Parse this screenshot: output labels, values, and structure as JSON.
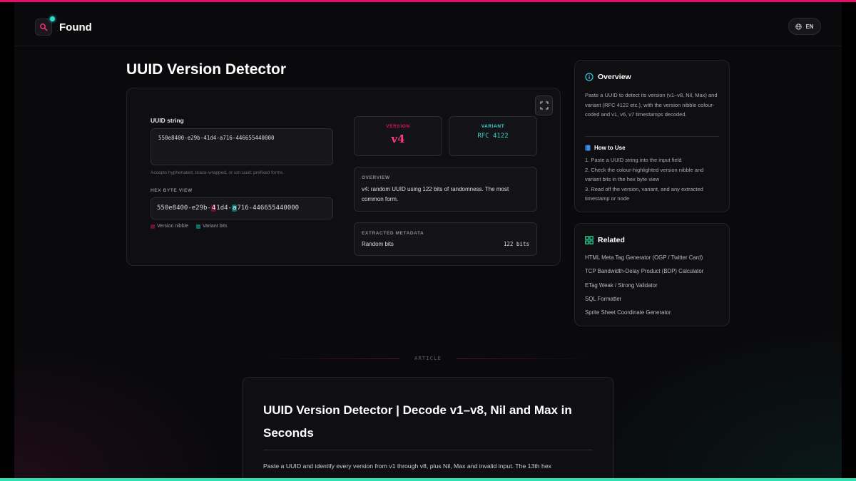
{
  "colors": {
    "accent_pink": "#e0106a",
    "accent_teal": "#2de0b0",
    "version_highlight": "#6a1238",
    "variant_highlight": "#0e6e6a"
  },
  "header": {
    "brand": "Found",
    "logo_icon": "search-icon",
    "language": "EN",
    "language_icon": "globe-icon"
  },
  "page": {
    "title": "UUID Version Detector"
  },
  "tool": {
    "input_label": "UUID string",
    "input_value": "550e8400-e29b-41d4-a716-446655440000",
    "input_hint": "Accepts hyphenated, brace-wrapped, or urn:uuid: prefixed forms.",
    "hex_label": "HEX BYTE VIEW",
    "hex": {
      "part1": "550e8400-e29b-",
      "version_nibble": "4",
      "part2": "1d4-",
      "variant_nibble": "a",
      "part3": "716-446655440000"
    },
    "legend_version": "Version nibble",
    "legend_variant": "Variant bits",
    "version_label": "VERSION",
    "version_value": "v4",
    "variant_label": "VARIANT",
    "variant_value": "RFC 4122",
    "overview_label": "OVERVIEW",
    "overview_text": "v4: random UUID using 122 bits of randomness. The most common form.",
    "metadata_label": "EXTRACTED METADATA",
    "metadata_key": "Random bits",
    "metadata_value": "122 bits",
    "fullscreen_icon": "expand-icon"
  },
  "sidebar": {
    "overview_title": "Overview",
    "overview_icon": "info-icon",
    "overview_text": "Paste a UUID to detect its version (v1–v8, Nil, Max) and variant (RFC 4122 etc.), with the version nibble colour-coded and v1, v6, v7 timestamps decoded.",
    "howto_title": "How to Use",
    "howto_icon": "book-icon",
    "howto_steps": [
      "1. Paste a UUID string into the input field",
      "2. Check the colour-highlighted version nibble and variant bits in the hex byte view",
      "3. Read off the version, variant, and any extracted timestamp or node"
    ],
    "related_title": "Related",
    "related_icon": "grid-icon",
    "related": [
      "HTML Meta Tag Generator (OGP / Twitter Card)",
      "TCP Bandwidth-Delay Product (BDP) Calculator",
      "ETag Weak / Strong Validator",
      "SQL Formatter",
      "Sprite Sheet Coordinate Generator"
    ]
  },
  "article": {
    "divider_label": "ARTICLE",
    "heading": "UUID Version Detector | Decode v1–v8, Nil and Max in Seconds",
    "intro": "Paste a UUID and identify every version from v1 through v8, plus Nil, Max and invalid input. The 13th hex"
  }
}
